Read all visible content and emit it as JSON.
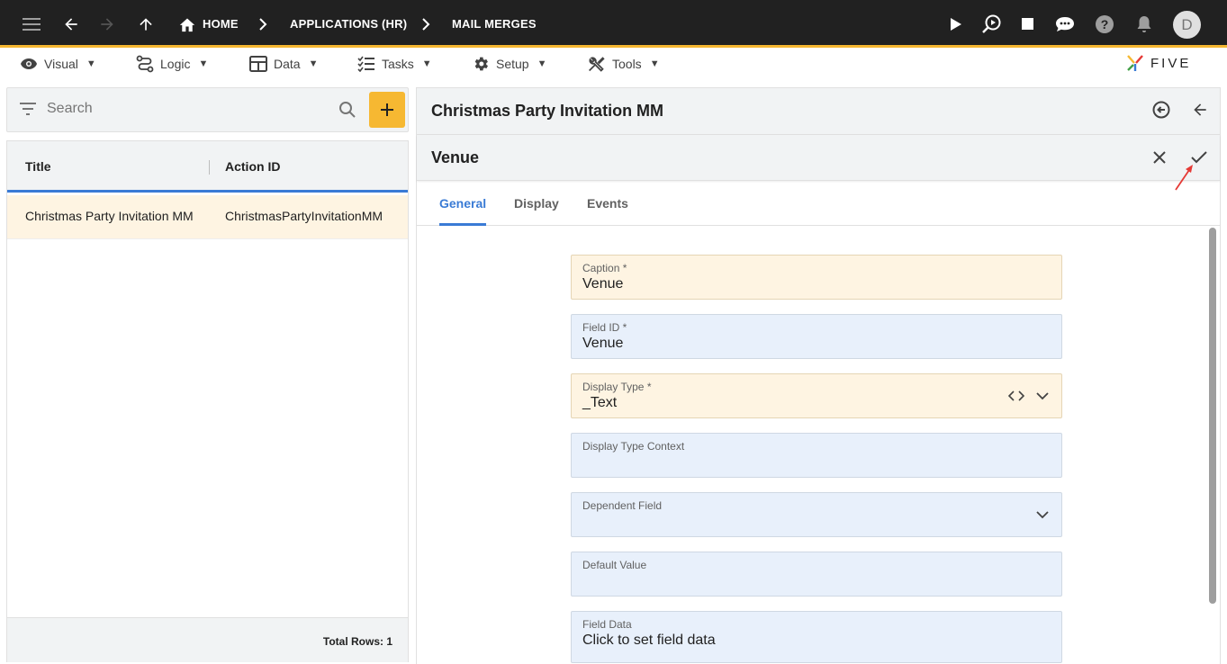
{
  "topbar": {
    "breadcrumbs": [
      "HOME",
      "APPLICATIONS (HR)",
      "MAIL MERGES"
    ],
    "avatar_initial": "D"
  },
  "menu": {
    "items": [
      {
        "label": "Visual",
        "icon": "eye-icon"
      },
      {
        "label": "Logic",
        "icon": "logic-icon"
      },
      {
        "label": "Data",
        "icon": "table-icon"
      },
      {
        "label": "Tasks",
        "icon": "tasks-icon"
      },
      {
        "label": "Setup",
        "icon": "gear-icon"
      },
      {
        "label": "Tools",
        "icon": "tools-icon"
      }
    ],
    "caret": "▼",
    "logo_text": "FIVE"
  },
  "list": {
    "search_placeholder": "Search",
    "columns": [
      "Title",
      "Action ID"
    ],
    "rows": [
      {
        "title": "Christmas Party Invitation MM",
        "action_id": "ChristmasPartyInvitationMM"
      }
    ],
    "total_rows": "Total Rows: 1"
  },
  "record": {
    "title": "Christmas Party Invitation MM"
  },
  "form": {
    "title": "Venue",
    "tabs": [
      "General",
      "Display",
      "Events"
    ],
    "fields": [
      {
        "label": "Caption *",
        "value": "Venue"
      },
      {
        "label": "Field ID *",
        "value": "Venue"
      },
      {
        "label": "Display Type *",
        "value": "_Text"
      },
      {
        "label": "Display Type Context",
        "value": ""
      },
      {
        "label": "Dependent Field",
        "value": ""
      },
      {
        "label": "Default Value",
        "value": ""
      },
      {
        "label": "Field Data",
        "value": "Click to set field data"
      }
    ]
  },
  "colors": {
    "topbar_bg": "#212121",
    "accent_yellow": "#f6b832",
    "accent_blue": "#3a7bd5",
    "required_field_bg": "#fef4e2",
    "field_bg": "#e8f0fb",
    "annotation_red": "#e53935"
  }
}
